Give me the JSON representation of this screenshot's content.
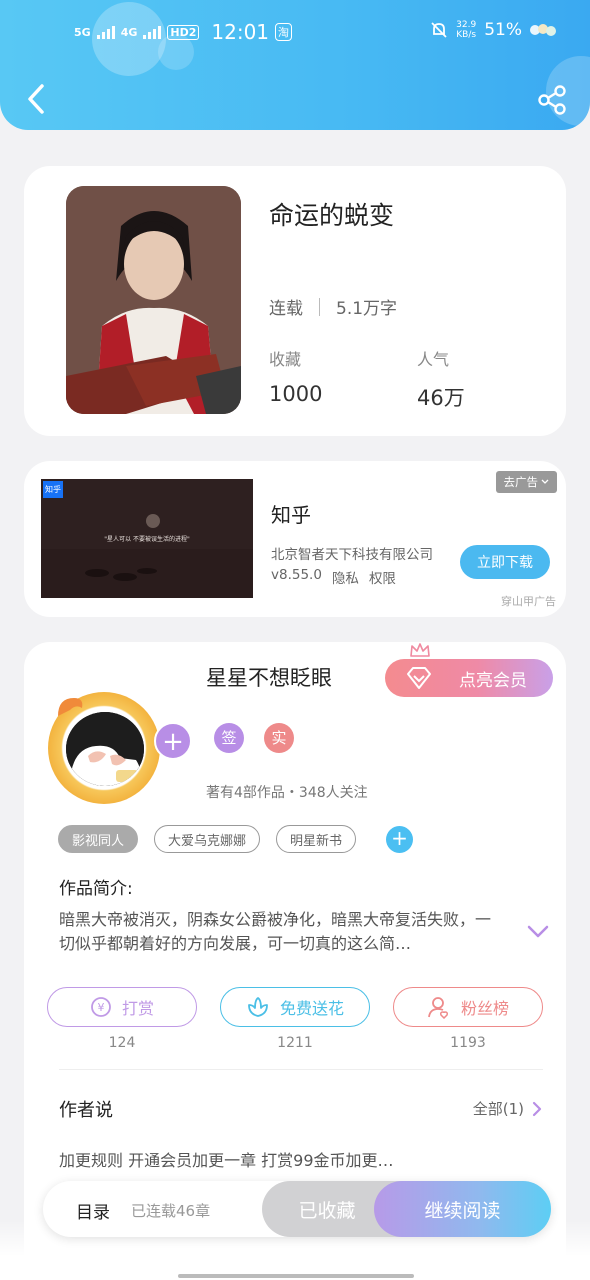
{
  "status_bar": {
    "signal_1": "5G",
    "signal_2": "4G",
    "hd": "HD2",
    "time": "12:01",
    "app_icon": "淘",
    "speed_value": "32.9",
    "speed_unit": "KB/s",
    "battery": "51%"
  },
  "nav": {
    "back_icon": "chevron-left-icon",
    "share_icon": "share-icon"
  },
  "book": {
    "title": "命运的蜕变",
    "status": "连载",
    "word_count": "5.1万字",
    "favorites_label": "收藏",
    "favorites_value": "1000",
    "popularity_label": "人气",
    "popularity_value": "46万"
  },
  "ad": {
    "badge": "知乎",
    "image_caption": "\"星人可以 不要被误生活的进程\"",
    "app_name": "知乎",
    "company": "北京智者天下科技有限公司",
    "version": "v8.55.0",
    "privacy": "隐私",
    "permissions": "权限",
    "download": "立即下载",
    "close": "去广告",
    "source": "穿山甲广告"
  },
  "author": {
    "name": "星星不想眨眼",
    "vip_button": "点亮会员",
    "badge_sign": "签",
    "badge_real": "实",
    "stats": "著有4部作品・348人关注",
    "tags": [
      "影视同人",
      "大爱乌克娜娜",
      "明星新书"
    ],
    "add_tag": "+",
    "plus": "+"
  },
  "intro": {
    "label": "作品简介:",
    "text": "暗黑大帝被消灭，阴森女公爵被净化，暗黑大帝复活失败，一切似乎都朝着好的方向发展，可一切真的这么简…"
  },
  "actions": [
    {
      "label": "打赏",
      "count": "124",
      "color": "#c09ae6",
      "icon": "coin-icon"
    },
    {
      "label": "免费送花",
      "count": "1211",
      "color": "#4bbfe6",
      "icon": "flower-icon"
    },
    {
      "label": "粉丝榜",
      "count": "1193",
      "color": "#ee8a8a",
      "icon": "fan-icon"
    }
  ],
  "author_say": {
    "label": "作者说",
    "all": "全部(1)",
    "text": "加更规则 开通会员加更一章 打赏99金币加更…"
  },
  "bottom": {
    "toc": "目录",
    "toc_info": "已连载46章",
    "collected": "已收藏",
    "continue": "继续阅读"
  },
  "colors": {
    "header": "#4ab9f3",
    "accent_purple": "#b88ee6",
    "accent_blue": "#4bbff2",
    "accent_red": "#ee8a8a"
  }
}
